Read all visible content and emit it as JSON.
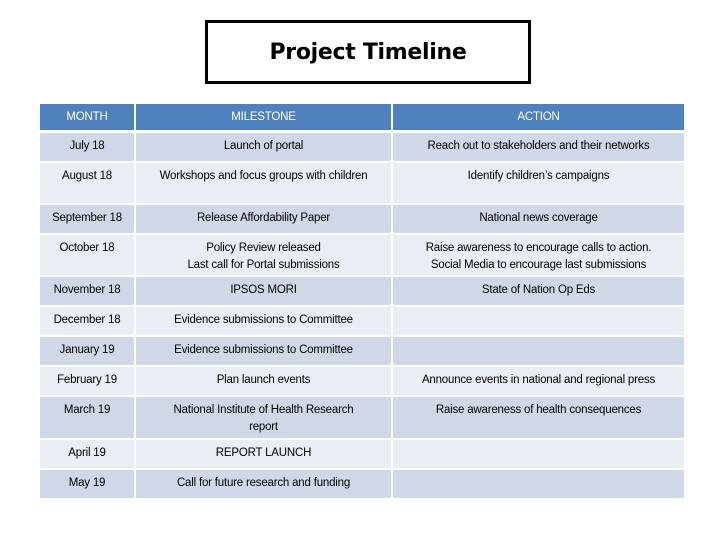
{
  "title": "Project Timeline",
  "table": {
    "headers": {
      "month": "MONTH",
      "milestone": "MILESTONE",
      "action": "ACTION"
    },
    "rows": [
      {
        "month": "July 18",
        "milestone": "Launch of portal",
        "milestone_line2": "",
        "action": "Reach out to stakeholders and their networks",
        "action_line2": ""
      },
      {
        "month": "August 18",
        "milestone": "Workshops and focus groups with children",
        "milestone_line2": "",
        "action": "Identify children’s campaigns",
        "action_line2": ""
      },
      {
        "month": "September 18",
        "milestone": "Release Affordability Paper",
        "milestone_line2": "",
        "action": "National news coverage",
        "action_line2": ""
      },
      {
        "month": "October 18",
        "milestone": "Policy Review released",
        "milestone_line2": "Last call for Portal submissions",
        "action": "Raise awareness to encourage calls to action.",
        "action_line2": "Social Media to encourage last submissions"
      },
      {
        "month": "November 18",
        "milestone": "IPSOS MORI",
        "milestone_line2": "",
        "action": "State of Nation Op Eds",
        "action_line2": ""
      },
      {
        "month": "December 18",
        "milestone": "Evidence submissions to Committee",
        "milestone_line2": "",
        "action": "",
        "action_line2": ""
      },
      {
        "month": "January 19",
        "milestone": "Evidence submissions to Committee",
        "milestone_line2": "",
        "action": "",
        "action_line2": ""
      },
      {
        "month": "February 19",
        "milestone": "Plan launch events",
        "milestone_line2": "",
        "action": "Announce events in national and regional press",
        "action_line2": ""
      },
      {
        "month": "March 19",
        "milestone": "National Institute of Health Research",
        "milestone_line2": "report",
        "action": "Raise awareness of health consequences",
        "action_line2": ""
      },
      {
        "month": "April 19",
        "milestone": "REPORT LAUNCH",
        "milestone_line2": "",
        "action": "",
        "action_line2": ""
      },
      {
        "month": "May 19",
        "milestone": "Call for future research and funding",
        "milestone_line2": "",
        "action": "",
        "action_line2": ""
      }
    ]
  },
  "colors": {
    "header_bg": "#4f81bd",
    "header_text": "#ffffff",
    "band_dark": "#d0d8e8",
    "band_light": "#e9edf4"
  }
}
